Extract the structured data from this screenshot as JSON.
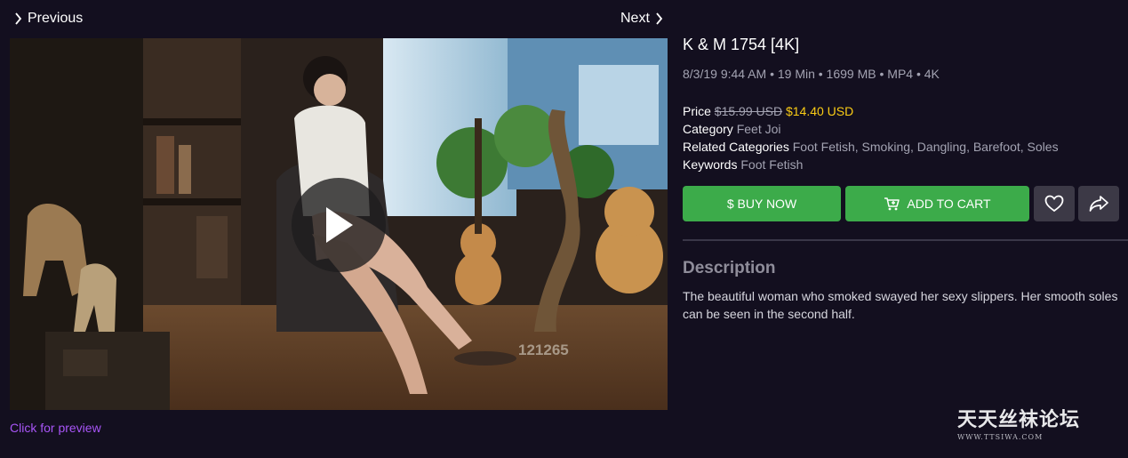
{
  "nav": {
    "previous_label": "Previous",
    "next_label": "Next"
  },
  "player": {
    "watermark_id": "121265",
    "preview_link": "Click for preview"
  },
  "product": {
    "title": "K & M 1754 [4K]",
    "meta": "8/3/19 9:44 AM • 19 Min • 1699 MB • MP4 • 4K",
    "price_label": "Price",
    "price_original": "$15.99 USD",
    "price_sale": "$14.40 USD",
    "category_label": "Category",
    "category_value": "Feet Joi",
    "related_label": "Related Categories",
    "related_value": "Foot Fetish, Smoking, Dangling, Barefoot, Soles",
    "keywords_label": "Keywords",
    "keywords_value": "Foot Fetish"
  },
  "actions": {
    "buy_label": "$ BUY NOW",
    "cart_label": "ADD TO CART",
    "favorite_icon": "heart-icon",
    "share_icon": "share-icon"
  },
  "description": {
    "heading": "Description",
    "text": "The beautiful woman who smoked swayed her sexy slippers. Her smooth soles can be seen in the second half."
  },
  "site_mark": {
    "cn": "天天丝袜论坛",
    "en": "WWW.TTSIWA.COM"
  },
  "colors": {
    "background": "#130f1f",
    "accent_green": "#3cab4a",
    "sale_yellow": "#facc15",
    "link_purple": "#a855f7",
    "icon_button": "#3c3946"
  }
}
